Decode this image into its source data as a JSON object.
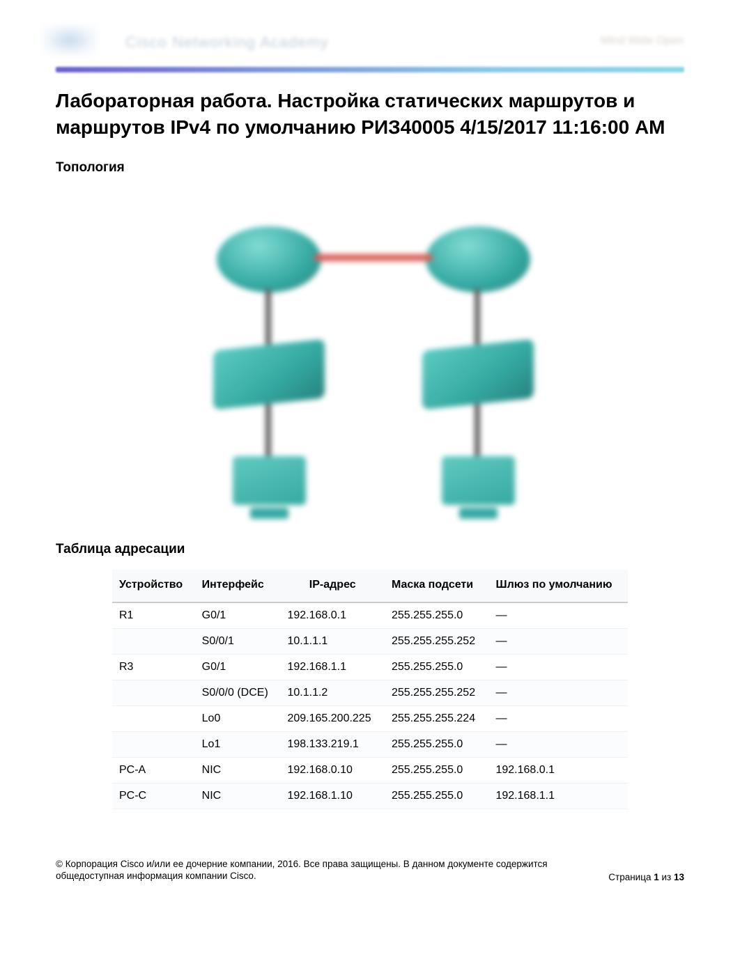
{
  "header": {
    "brand_blur": "Cisco Networking Academy",
    "right_blur": "Mind Wide Open"
  },
  "title": "Лабораторная работа. Настройка статических маршрутов и маршрутов IPv4 по умолчанию РИЗ40005 4/15/2017 11:16:00 AM",
  "sections": {
    "topology": "Топология",
    "addressing": "Таблица адресации"
  },
  "table": {
    "headers": {
      "device": "Устройство",
      "interface": "Интерфейс",
      "ip": "IP-адрес",
      "mask": "Маска подсети",
      "gateway": "Шлюз по умолчанию"
    },
    "rows": [
      {
        "device": "R1",
        "interface": "G0/1",
        "ip": "192.168.0.1",
        "mask": "255.255.255.0",
        "gateway": "—"
      },
      {
        "device": "",
        "interface": "S0/0/1",
        "ip": "10.1.1.1",
        "mask": "255.255.255.252",
        "gateway": "—"
      },
      {
        "device": "R3",
        "interface": "G0/1",
        "ip": "192.168.1.1",
        "mask": "255.255.255.0",
        "gateway": "—"
      },
      {
        "device": "",
        "interface": "S0/0/0 (DCE)",
        "ip": "10.1.1.2",
        "mask": "255.255.255.252",
        "gateway": "—"
      },
      {
        "device": "",
        "interface": "Lo0",
        "ip": "209.165.200.225",
        "mask": "255.255.255.224",
        "gateway": "—"
      },
      {
        "device": "",
        "interface": "Lo1",
        "ip": "198.133.219.1",
        "mask": "255.255.255.0",
        "gateway": "—"
      },
      {
        "device": "PC-A",
        "interface": "NIC",
        "ip": "192.168.0.10",
        "mask": "255.255.255.0",
        "gateway": "192.168.0.1"
      },
      {
        "device": "PC-C",
        "interface": "NIC",
        "ip": "192.168.1.10",
        "mask": "255.255.255.0",
        "gateway": "192.168.1.1"
      }
    ]
  },
  "footer": {
    "copyright": "© Корпорация Cisco и/или ее дочерние компании, 2016. Все права защищены. В данном документе содержится общедоступная информация компании Cisco.",
    "page_label_prefix": "Страница ",
    "page_current": "1",
    "page_sep": " из ",
    "page_total": "13"
  }
}
